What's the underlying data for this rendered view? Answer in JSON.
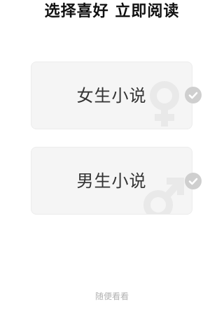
{
  "title": "选择喜好 立即阅读",
  "options": [
    {
      "label": "女生小说",
      "icon": "female-symbol-icon",
      "selected": false
    },
    {
      "label": "男生小说",
      "icon": "male-symbol-icon",
      "selected": false
    }
  ],
  "skip_label": "随便看看",
  "colors": {
    "background": "#ffffff",
    "card_background": "#f5f5f5",
    "check_circle": "#cfcfcf",
    "watermark_icon": "#e9e9e9",
    "text": "#333333",
    "muted_text": "#b3b3b3"
  }
}
